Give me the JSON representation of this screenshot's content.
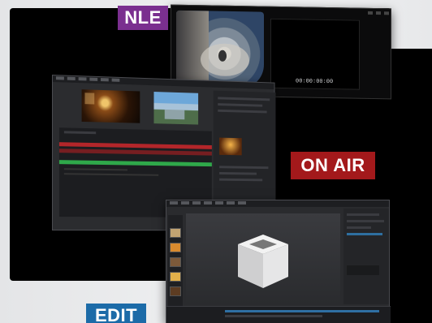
{
  "labels": {
    "nle": "NLE",
    "on_air": "ON AIR",
    "edit": "EDIT"
  },
  "nle_window": {
    "timecode": "00:00:00:00"
  },
  "colors": {
    "nle_tag": "#7a2f8f",
    "on_air_tag": "#a3191b",
    "edit_tag": "#1c6ba8",
    "timeline_red": "#b3262a",
    "timeline_green": "#2fa84a"
  }
}
